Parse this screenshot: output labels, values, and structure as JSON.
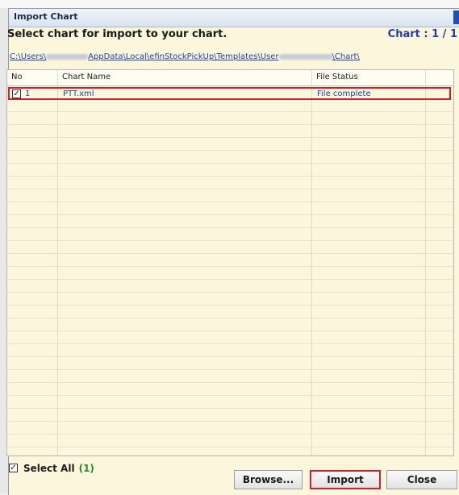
{
  "window": {
    "title": "Import Chart"
  },
  "header": {
    "prompt": "Select chart for import to your chart.",
    "count_label": "Chart : 1 / 1"
  },
  "path": {
    "segments": [
      "C:\\Users\\",
      "AppData\\Local\\efinStockPickUp\\Templates\\User",
      "\\Chart\\"
    ]
  },
  "table": {
    "columns": [
      "No",
      "Chart Name",
      "File Status"
    ],
    "rows": [
      {
        "checked": true,
        "no": "1",
        "name": "PTT.xml",
        "status": "File complete"
      }
    ]
  },
  "footer": {
    "select_all_label": "Select All",
    "select_all_count": "(1)",
    "select_all_checked": true
  },
  "buttons": {
    "browse": "Browse...",
    "import": "Import",
    "close": "Close"
  },
  "colors": {
    "highlight": "#d0202a",
    "link": "#1d40b0",
    "count": "#1f3fa8"
  }
}
